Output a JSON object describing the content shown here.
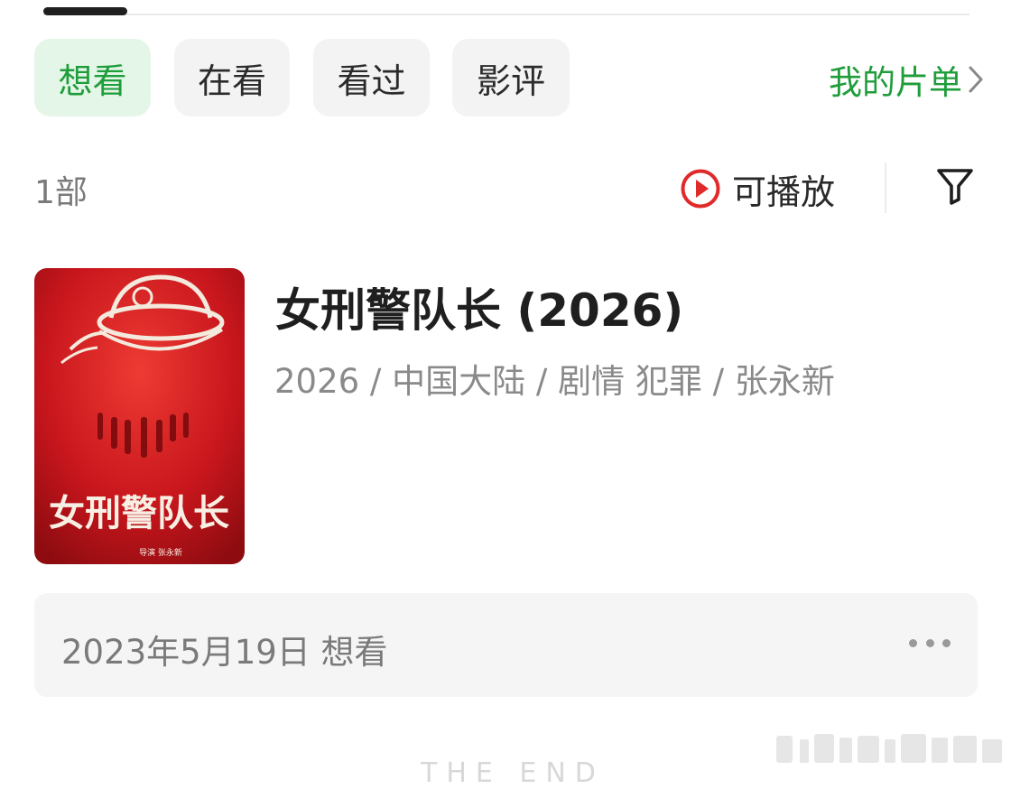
{
  "tabs": [
    {
      "label": "想看",
      "active": true
    },
    {
      "label": "在看",
      "active": false
    },
    {
      "label": "看过",
      "active": false
    },
    {
      "label": "影评",
      "active": false
    }
  ],
  "my_list": {
    "label": "我的片单",
    "icon": "chevron-right-icon"
  },
  "list_header": {
    "count": "1部",
    "playable_label": "可播放",
    "playable_icon": "play-circle-icon",
    "filter_icon": "filter-funnel-icon"
  },
  "item": {
    "title": "女刑警队长 (2026)",
    "meta": "2026 / 中国大陆 / 剧情 犯罪 / 张永新",
    "poster": {
      "title_art": "女刑警队长",
      "credit": "导演 张永新"
    }
  },
  "record": {
    "text": "2023年5月19日 想看",
    "more_icon": "more-dots-icon"
  },
  "footer": {
    "end_text": "THE END"
  },
  "colors": {
    "accent_green": "#1f9d3a",
    "active_tab_bg": "#e3f6e7",
    "play_red": "#e02a2a",
    "poster_red": "#c8161d"
  }
}
